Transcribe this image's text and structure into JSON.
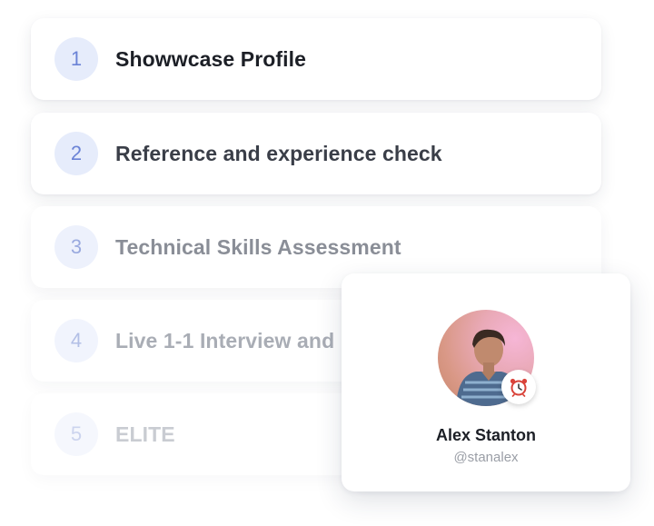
{
  "steps": [
    {
      "number": "1",
      "label": "Showwcase Profile"
    },
    {
      "number": "2",
      "label": "Reference and experience check"
    },
    {
      "number": "3",
      "label": "Technical Skills Assessment"
    },
    {
      "number": "4",
      "label": "Live 1-1 Interview and"
    },
    {
      "number": "5",
      "label": "ELITE"
    }
  ],
  "profile": {
    "name": "Alex Stanton",
    "handle": "@stanalex",
    "badge_icon": "alarm-clock-icon",
    "avatar_icon": "user-photo"
  },
  "colors": {
    "number_circle_bg": "#e6ecfb",
    "number_text": "#6b83d6",
    "label_text": "#1c1f26",
    "handle_text": "#9a9ea6"
  }
}
